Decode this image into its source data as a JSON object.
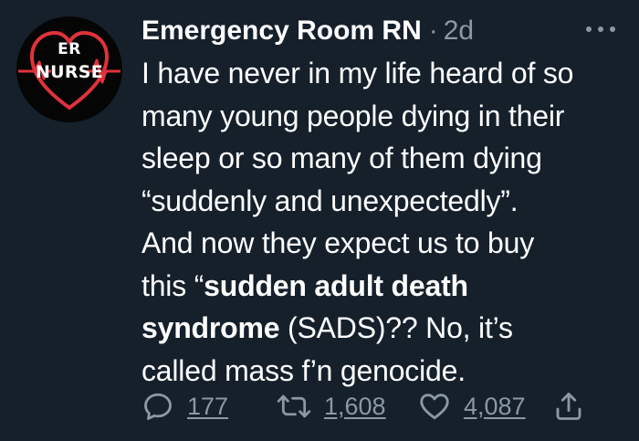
{
  "author": {
    "name": "Emergency Room RN",
    "separator": "·",
    "timestamp": "2d",
    "avatar": {
      "top_text": "ER",
      "bottom_text": "NURSE",
      "heart_color": "#e0323a",
      "pulse_color": "#e0323a"
    }
  },
  "tweet": {
    "lines": [
      [
        {
          "text": "I have never in my life heard of so",
          "bold": false
        }
      ],
      [
        {
          "text": "many young people dying in their",
          "bold": false
        }
      ],
      [
        {
          "text": "sleep or so many of them dying",
          "bold": false
        }
      ],
      [
        {
          "text": "“suddenly and unexpectedly”.",
          "bold": false
        }
      ],
      [
        {
          "text": "And now they expect us to buy",
          "bold": false
        }
      ],
      [
        {
          "text": "this “",
          "bold": false
        },
        {
          "text": "sudden adult death",
          "bold": true
        }
      ],
      [
        {
          "text": "syndrome",
          "bold": true
        },
        {
          "text": " (SADS)?? No, it’s",
          "bold": false
        }
      ],
      [
        {
          "text": "called mass f’n genocide.",
          "bold": false
        }
      ]
    ]
  },
  "actions": {
    "reply": {
      "icon": "reply-icon",
      "count": "177"
    },
    "retweet": {
      "icon": "retweet-icon",
      "count": "1,608"
    },
    "like": {
      "icon": "heart-icon",
      "count": "4,087"
    },
    "share": {
      "icon": "share-icon"
    }
  },
  "colors": {
    "background": "#15202b",
    "text": "#ffffff",
    "secondary": "#8b98a5"
  }
}
